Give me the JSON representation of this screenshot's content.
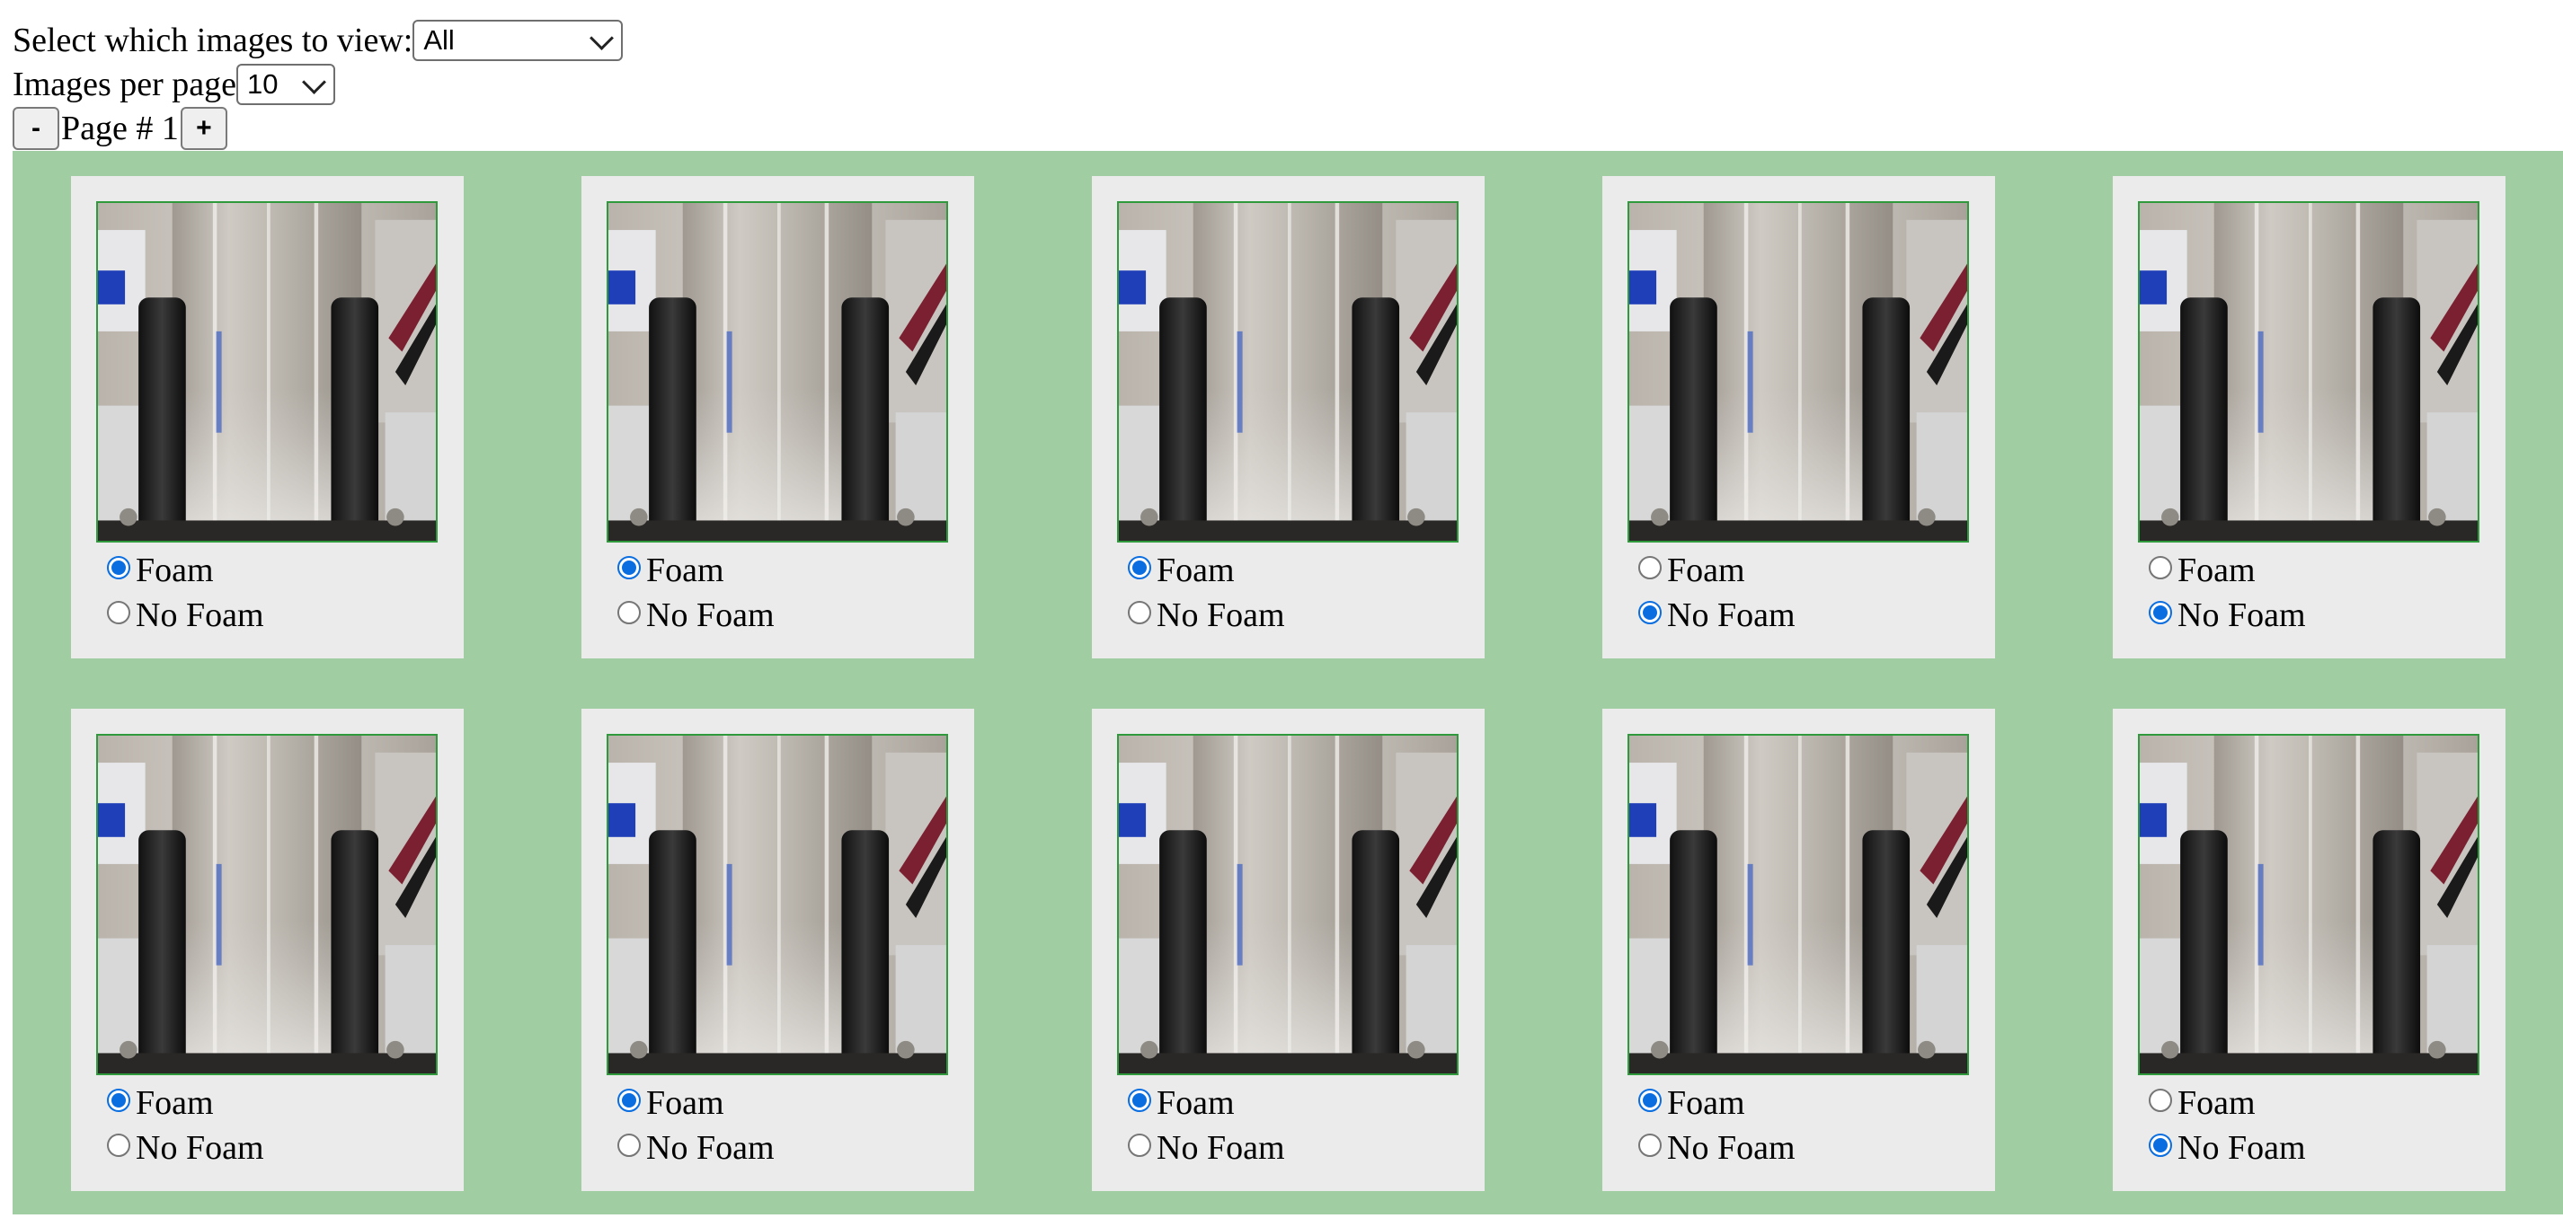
{
  "controls": {
    "view_label": "Select which images to view:",
    "view_selected": "All",
    "per_page_label": "Images per page",
    "per_page_selected": "10",
    "page_minus": "-",
    "page_label": "Page # 1",
    "page_plus": "+"
  },
  "options": {
    "foam": "Foam",
    "no_foam": "No Foam"
  },
  "images": [
    {
      "selection": "Foam"
    },
    {
      "selection": "Foam"
    },
    {
      "selection": "Foam"
    },
    {
      "selection": "No Foam"
    },
    {
      "selection": "No Foam"
    },
    {
      "selection": "Foam"
    },
    {
      "selection": "Foam"
    },
    {
      "selection": "Foam"
    },
    {
      "selection": "Foam"
    },
    {
      "selection": "No Foam"
    }
  ],
  "colors": {
    "gallery_bg": "#a0cda1",
    "card_bg": "#ebebeb",
    "image_border": "#2f9a3b",
    "radio_selected": "#0a6ee0"
  }
}
